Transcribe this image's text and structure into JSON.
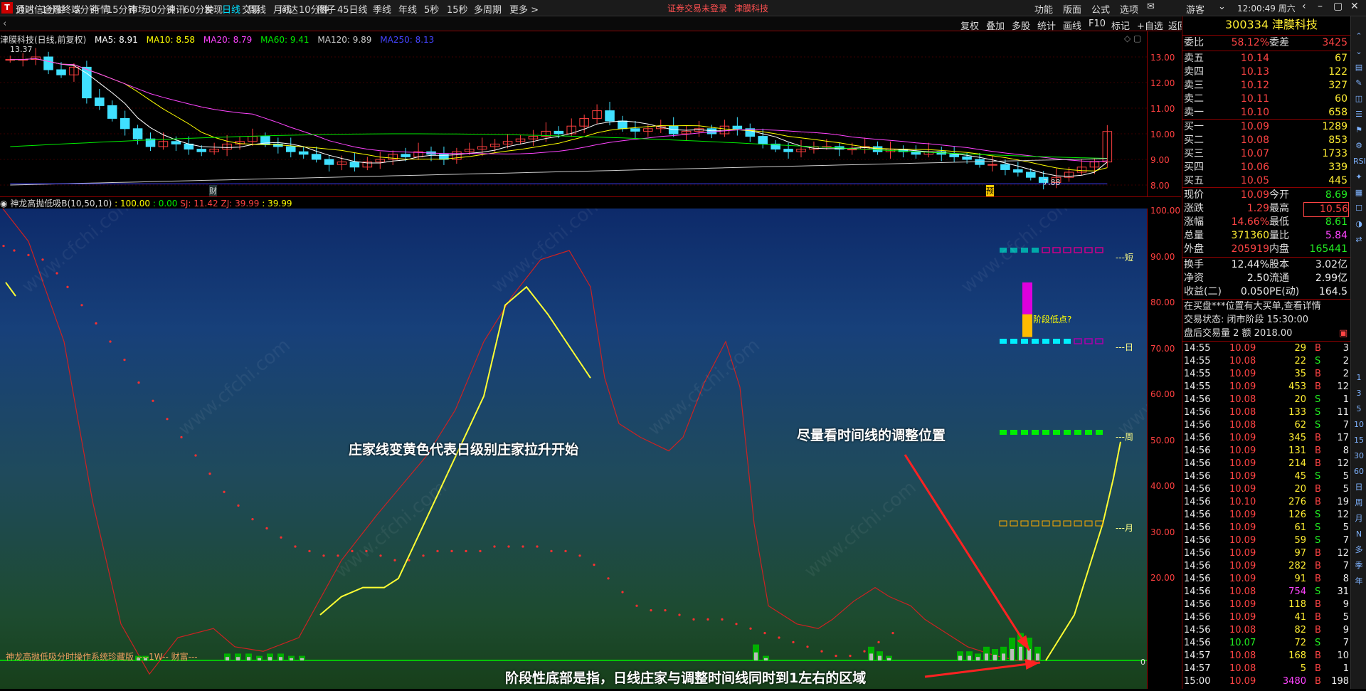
{
  "top": {
    "app_title": "通达信金融终端",
    "menus": [
      "行情",
      "市场",
      "资讯",
      "发现",
      "交易",
      "问达",
      "圈子"
    ],
    "warning": "证券交易未登录",
    "stock_name": "津膜科技",
    "right_menus": [
      "功能",
      "版面",
      "公式",
      "选项"
    ],
    "user": "游客",
    "clock": "12:00:49 周六"
  },
  "periods": [
    "分时",
    "1分钟",
    "5分钟",
    "15分钟",
    "30分钟",
    "60分钟",
    "日线",
    "周线",
    "月线",
    "10分钟",
    "45日线",
    "季线",
    "年线",
    "5秒",
    "15秒",
    "多周期",
    "更多 >"
  ],
  "active_period": "日线",
  "right_tools": [
    "复权",
    "叠加",
    "多股",
    "统计",
    "画线",
    "F10",
    "标记",
    "+自选",
    "返回"
  ],
  "main_legend": {
    "name": "津膜科技(日线,前复权)",
    "ma5": "MA5: 8.91",
    "ma10": "MA10: 8.58",
    "ma20": "MA20: 8.79",
    "ma60": "MA60: 9.41",
    "ma120": "MA120: 9.89",
    "ma250": "MA250: 8.13"
  },
  "main_axis": [
    "13.00",
    "12.00",
    "11.00",
    "10.00",
    "9.00",
    "8.00"
  ],
  "main_marks": {
    "high": "13.37",
    "low": "7.88",
    "cai": "财",
    "yu": "预"
  },
  "indicator_legend": {
    "name": "神龙高抛低吸B(10,50,10)",
    "v1": "100.00",
    "v2": "0.00",
    "sj": "SJ: 11.42",
    "zj": "ZJ: 39.99",
    "v5": "39.99"
  },
  "ind_axis": [
    "100.00",
    "90.00",
    "80.00",
    "70.00",
    "60.00",
    "50.00",
    "40.00",
    "30.00",
    "20.00"
  ],
  "ind_bottom_left": "神龙高抛低吸分时操作系统珍藏版 ----1W-- 财富---",
  "ind_zero": "0",
  "tf_labels": {
    "short": "短",
    "day": "日",
    "week": "周",
    "month": "月"
  },
  "stage_low": "阶段低点?",
  "annotations": {
    "a1": "庄家线变黄色代表日级别庄家拉升开始",
    "a2": "尽量看时间线的调整位置",
    "a3": "阶段性底部是指，日线庄家与调整时间线同时到1左右的区域"
  },
  "rp": {
    "code": "300334",
    "name": "津膜科技",
    "weibi_lbl": "委比",
    "weibi": "58.12%",
    "weicha_lbl": "委差",
    "weicha": "3425",
    "asks": [
      {
        "lbl": "卖五",
        "p": "10.14",
        "v": "67"
      },
      {
        "lbl": "卖四",
        "p": "10.13",
        "v": "122"
      },
      {
        "lbl": "卖三",
        "p": "10.12",
        "v": "327"
      },
      {
        "lbl": "卖二",
        "p": "10.11",
        "v": "60"
      },
      {
        "lbl": "卖一",
        "p": "10.10",
        "v": "658"
      }
    ],
    "bids": [
      {
        "lbl": "买一",
        "p": "10.09",
        "v": "1289"
      },
      {
        "lbl": "买二",
        "p": "10.08",
        "v": "853"
      },
      {
        "lbl": "买三",
        "p": "10.07",
        "v": "1733"
      },
      {
        "lbl": "买四",
        "p": "10.06",
        "v": "339"
      },
      {
        "lbl": "买五",
        "p": "10.05",
        "v": "445"
      }
    ],
    "stats": [
      {
        "l1": "现价",
        "v1": "10.09",
        "c1": "red",
        "l2": "今开",
        "v2": "8.69",
        "c2": "green"
      },
      {
        "l1": "涨跌",
        "v1": "1.29",
        "c1": "red",
        "l2": "最高",
        "v2": "10.56",
        "c2": "redbox"
      },
      {
        "l1": "涨幅",
        "v1": "14.66%",
        "c1": "red",
        "l2": "最低",
        "v2": "8.61",
        "c2": "green"
      },
      {
        "l1": "总量",
        "v1": "371360",
        "c1": "yellow",
        "l2": "量比",
        "v2": "5.84",
        "c2": "mag"
      },
      {
        "l1": "外盘",
        "v1": "205919",
        "c1": "red",
        "l2": "内盘",
        "v2": "165441",
        "c2": "green"
      }
    ],
    "stats2": [
      {
        "l1": "换手",
        "v1": "12.44%",
        "l2": "股本",
        "v2": "3.02亿"
      },
      {
        "l1": "净资",
        "v1": "2.50",
        "l2": "流通",
        "v2": "2.99亿"
      },
      {
        "l1": "收益(二)",
        "v1": "0.050",
        "l2": "PE(动)",
        "v2": "164.5"
      }
    ],
    "notice": "在买盘***位置有大买单,查看详情",
    "trade_state": "交易状态: 闭市阶段 15:30:00",
    "after": "盘后交易量 2 额 2018.00",
    "ticks": [
      [
        "14:55",
        "10.09",
        "29",
        "B",
        "3"
      ],
      [
        "14:55",
        "10.08",
        "22",
        "S",
        "2"
      ],
      [
        "14:55",
        "10.09",
        "35",
        "B",
        "2"
      ],
      [
        "14:55",
        "10.09",
        "453",
        "B",
        "12"
      ],
      [
        "14:56",
        "10.08",
        "20",
        "S",
        "1"
      ],
      [
        "14:56",
        "10.08",
        "133",
        "S",
        "11"
      ],
      [
        "14:56",
        "10.08",
        "62",
        "S",
        "7"
      ],
      [
        "14:56",
        "10.09",
        "345",
        "B",
        "17"
      ],
      [
        "14:56",
        "10.09",
        "131",
        "B",
        "8"
      ],
      [
        "14:56",
        "10.09",
        "214",
        "B",
        "12"
      ],
      [
        "14:56",
        "10.09",
        "45",
        "S",
        "5"
      ],
      [
        "14:56",
        "10.09",
        "20",
        "B",
        "5"
      ],
      [
        "14:56",
        "10.10",
        "276",
        "B",
        "19"
      ],
      [
        "14:56",
        "10.09",
        "126",
        "S",
        "12"
      ],
      [
        "14:56",
        "10.09",
        "61",
        "S",
        "5"
      ],
      [
        "14:56",
        "10.09",
        "59",
        "S",
        "7"
      ],
      [
        "14:56",
        "10.09",
        "97",
        "B",
        "12"
      ],
      [
        "14:56",
        "10.09",
        "282",
        "B",
        "7"
      ],
      [
        "14:56",
        "10.09",
        "91",
        "B",
        "8"
      ],
      [
        "14:56",
        "10.08",
        "754",
        "S",
        "31"
      ],
      [
        "14:56",
        "10.09",
        "118",
        "B",
        "9"
      ],
      [
        "14:56",
        "10.09",
        "41",
        "B",
        "5"
      ],
      [
        "14:56",
        "10.08",
        "82",
        "B",
        "9"
      ],
      [
        "14:56",
        "10.07",
        "72",
        "S",
        "7"
      ],
      [
        "14:57",
        "10.08",
        "168",
        "B",
        "10"
      ],
      [
        "14:57",
        "10.08",
        "5",
        "B",
        "1"
      ],
      [
        "15:00",
        "10.09",
        "3480",
        "B",
        "198"
      ]
    ]
  },
  "strip_icons": [
    "1",
    "3",
    "5",
    "10",
    "15",
    "30",
    "60",
    "日",
    "周",
    "月",
    "N",
    "多",
    "季",
    "年"
  ],
  "colors": {
    "ma5": "#ffffff",
    "ma10": "#ffff00",
    "ma20": "#ff44ff",
    "ma60": "#00ee00",
    "ma120": "#cccccc",
    "ma250": "#4040ff"
  }
}
